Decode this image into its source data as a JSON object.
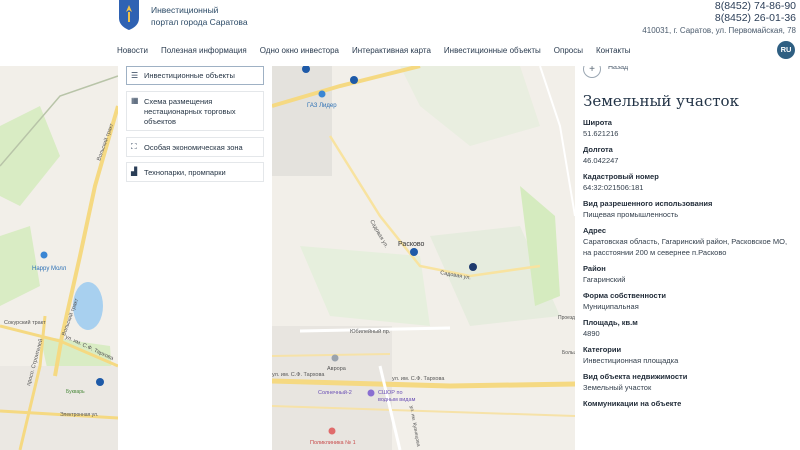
{
  "header": {
    "site_title_line1": "Инвестиционный",
    "site_title_line2": "портал города Саратова",
    "phone1": "8(8452) 74-86-90",
    "phone2": "8(8452) 26-01-36",
    "address": "410031, г. Саратов, ул. Первомайская, 78",
    "language": "RU"
  },
  "nav": [
    {
      "label": "Новости"
    },
    {
      "label": "Полезная информация"
    },
    {
      "label": "Одно окно инвестора"
    },
    {
      "label": "Интерактивная карта"
    },
    {
      "label": "Инвестиционные объекты"
    },
    {
      "label": "Опросы"
    },
    {
      "label": "Контакты"
    }
  ],
  "layers": [
    {
      "label": "Инвестиционные объекты",
      "icon": "list-icon"
    },
    {
      "label": "Схема размещения нестационарных торговых объектов",
      "icon": "store-icon"
    },
    {
      "label": "Особая экономическая зона",
      "icon": "zone-icon"
    },
    {
      "label": "Технопарки, промпарки",
      "icon": "factory-icon"
    }
  ],
  "map_labels": {
    "gaz": "ГАЗ Лидер",
    "raskovo": "Расково",
    "happy": "Happy Молл",
    "sokur": "Сокурский тракт",
    "volsky": "Вольский тракт",
    "tarkhova1": "ул. им. С.Ф. Тархова",
    "tarkhova2": "ул. им. С.Ф. Тархова",
    "tarkhova3": "ул. им. С.Ф. Тархова",
    "sadovaya1": "Садовая ул.",
    "sadovaya2": "Садовая ул.",
    "yubileyny": "Юбилейный пр.",
    "avrora": "Аврора",
    "solnechny": "Солнечный-2",
    "sshor1": "СШОР по",
    "sshor2": "водным видам",
    "poliklinika": "Поликлиника № 1",
    "strog": "просп. Строителей",
    "bukvar": "Букварь",
    "elektronnaya": "Электронная ул.",
    "kuznetsova": "ул. им. Кузнецова",
    "proezd": "Проезд",
    "bolsh": "Больш"
  },
  "info": {
    "back_label": "Назад",
    "title": "Земельный участок",
    "fields": [
      {
        "label": "Широта",
        "value": "51.621216"
      },
      {
        "label": "Долгота",
        "value": "46.042247"
      },
      {
        "label": "Кадастровый номер",
        "value": "64:32:021506:181"
      },
      {
        "label": "Вид разрешенного использования",
        "value": "Пищевая промышленность"
      },
      {
        "label": "Адрес",
        "value": "Саратовская область, Гагаринский район, Расковское МО, на расстоянии 200 м севернее п.Расково"
      },
      {
        "label": "Район",
        "value": "Гагаринский"
      },
      {
        "label": "Форма собственности",
        "value": "Муниципальная"
      },
      {
        "label": "Площадь, кв.м",
        "value": "4890"
      },
      {
        "label": "Категории",
        "value": "Инвестиционная площадка"
      },
      {
        "label": "Вид объекта недвижимости",
        "value": "Земельный участок"
      },
      {
        "label": "Коммуникации на объекте",
        "value": ""
      }
    ]
  },
  "colors": {
    "accent": "#2f5f82",
    "marker": "#1e5aa8",
    "road": "#f5d982",
    "water": "#a8d0ef",
    "green": "#cfe8b5"
  }
}
